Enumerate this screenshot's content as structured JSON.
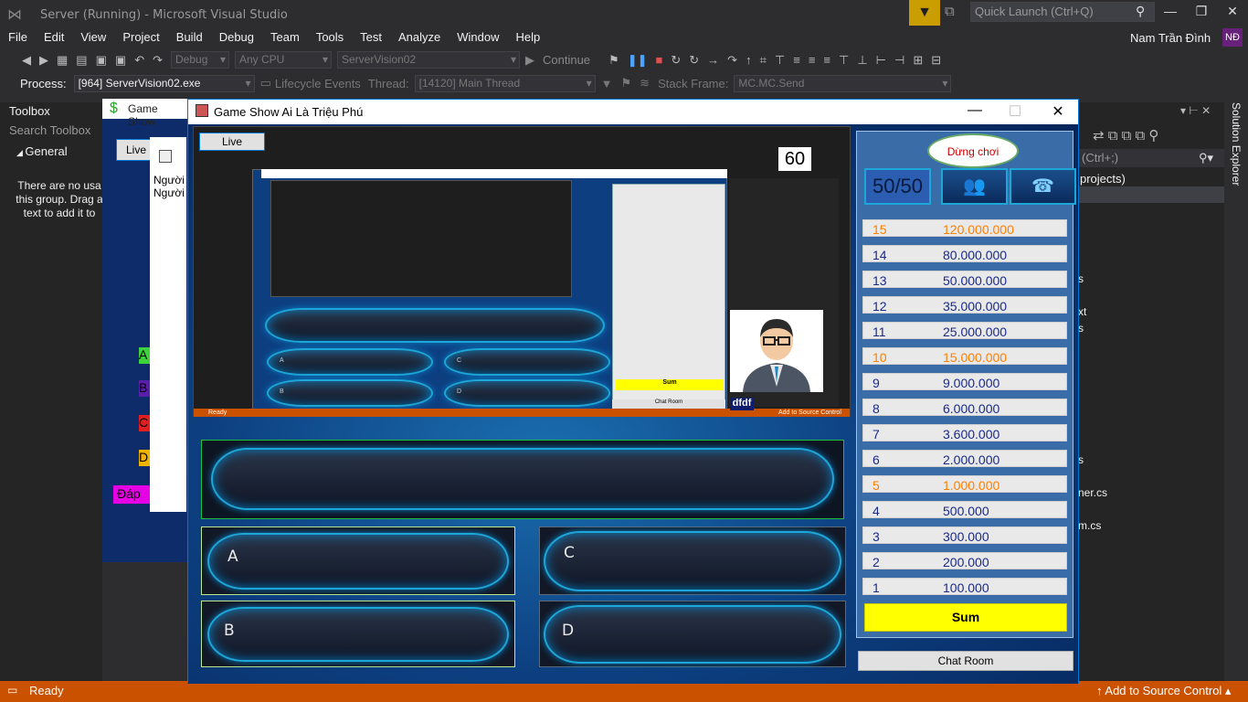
{
  "vs": {
    "title": "Server (Running) - Microsoft Visual Studio",
    "quick_launch_placeholder": "Quick Launch (Ctrl+Q)",
    "menu": [
      "File",
      "Edit",
      "View",
      "Project",
      "Build",
      "Debug",
      "Team",
      "Tools",
      "Test",
      "Analyze",
      "Window",
      "Help"
    ],
    "user_name": "Nam Trần Đình",
    "user_initials": "NĐ",
    "toolbar": {
      "config": "Debug",
      "platform": "Any CPU",
      "startup": "ServerVision02",
      "continue": "Continue"
    },
    "debug": {
      "process_label": "Process:",
      "process_value": "[964] ServerVision02.exe",
      "lifecycle": "Lifecycle Events",
      "thread_label": "Thread:",
      "thread_value": "[14120] Main Thread",
      "stack_label": "Stack Frame:",
      "stack_value": "MC.MC.Send"
    },
    "toolbox": {
      "title": "Toolbox",
      "search": "Search Toolbox",
      "group": "General",
      "empty_text": "There are no usa this group. Drag a text to add it to"
    },
    "solution": {
      "tab_label": "Solution Explorer",
      "search": "(Ctrl+;)",
      "projects": "projects)",
      "frag1": "s",
      "frag2": "xt",
      "frag3": "s",
      "frag4": "s",
      "frag5": "ner.cs",
      "frag6": "m.cs"
    },
    "status": {
      "left": "Ready",
      "right": "Add to Source Control"
    }
  },
  "bg_game": {
    "title": "Game Show",
    "live": "Live",
    "names": [
      "Người",
      "Người"
    ],
    "answer_tags": [
      "A",
      "B",
      "C",
      "D"
    ],
    "dap": "Đáp"
  },
  "game": {
    "title": "Game Show Ai Là Triệu Phú",
    "stop_label": "Dừng chơi",
    "lifeline_5050": "50/50",
    "answers": [
      "A",
      "B",
      "C",
      "D"
    ],
    "prizes": [
      {
        "n": "15",
        "v": "120.000.000",
        "safe": true
      },
      {
        "n": "14",
        "v": "80.000.000",
        "safe": false
      },
      {
        "n": "13",
        "v": "50.000.000",
        "safe": false
      },
      {
        "n": "12",
        "v": "35.000.000",
        "safe": false
      },
      {
        "n": "11",
        "v": "25.000.000",
        "safe": false
      },
      {
        "n": "10",
        "v": "15.000.000",
        "safe": true
      },
      {
        "n": "9",
        "v": "9.000.000",
        "safe": false
      },
      {
        "n": "8",
        "v": "6.000.000",
        "safe": false
      },
      {
        "n": "7",
        "v": "3.600.000",
        "safe": false
      },
      {
        "n": "6",
        "v": "2.000.000",
        "safe": false
      },
      {
        "n": "5",
        "v": "1.000.000",
        "safe": true
      },
      {
        "n": "4",
        "v": "500.000",
        "safe": false
      },
      {
        "n": "3",
        "v": "300.000",
        "safe": false
      },
      {
        "n": "2",
        "v": "200.000",
        "safe": false
      },
      {
        "n": "1",
        "v": "100.000",
        "safe": false
      }
    ],
    "sum": "Sum",
    "chat_room": "Chat Room",
    "shot": {
      "live": "Live",
      "timer": "60",
      "name": "dfdf",
      "sum": "Sum",
      "chat": "Chat Room",
      "ready": "Ready",
      "source": "Add to Source Control",
      "answers": [
        "A",
        "B",
        "C",
        "D"
      ]
    }
  }
}
